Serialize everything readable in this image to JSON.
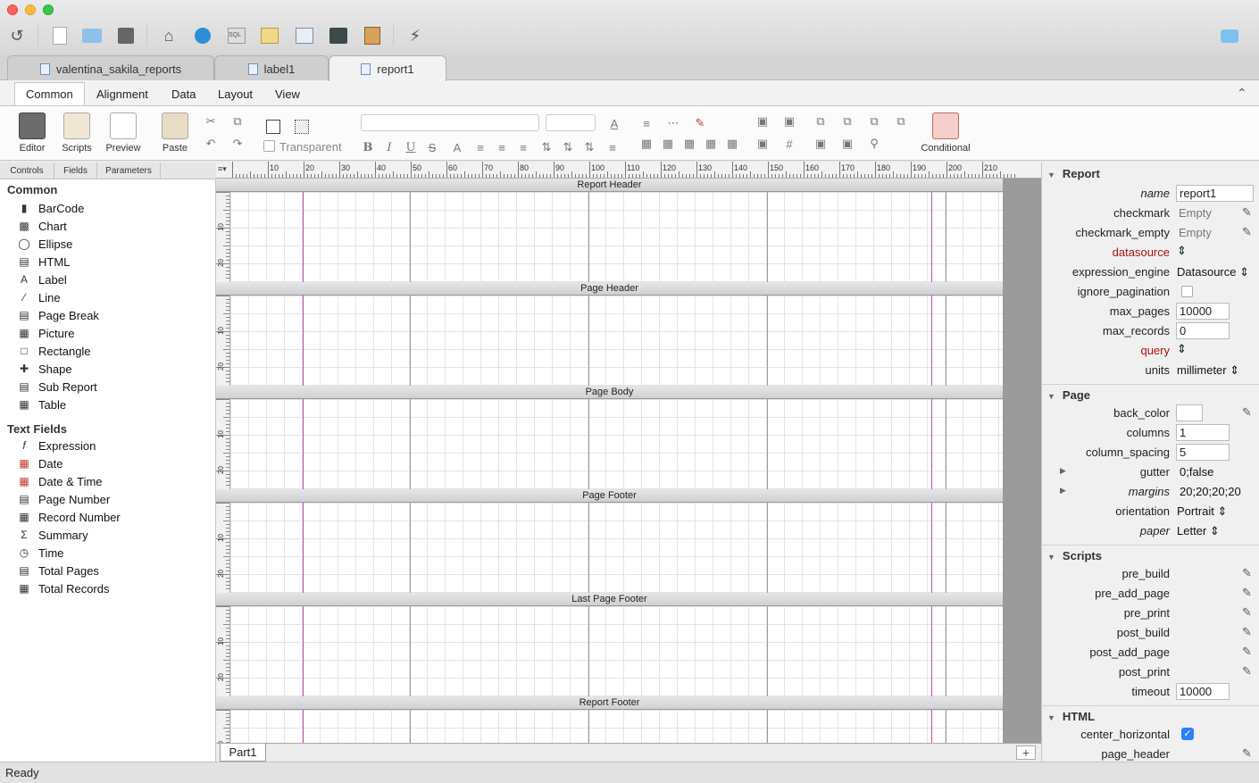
{
  "document_tabs": [
    {
      "label": "valentina_sakila_reports"
    },
    {
      "label": "label1"
    },
    {
      "label": "report1",
      "active": true
    }
  ],
  "ribbon_tabs": [
    "Common",
    "Alignment",
    "Data",
    "Layout",
    "View"
  ],
  "ribbon": {
    "editor": "Editor",
    "scripts": "Scripts",
    "preview": "Preview",
    "paste": "Paste",
    "transparent": "Transparent",
    "conditional": "Conditional"
  },
  "left_tabs": [
    "Controls",
    "Fields",
    "Parameters"
  ],
  "controls": {
    "common_title": "Common",
    "common": [
      "BarCode",
      "Chart",
      "Ellipse",
      "HTML",
      "Label",
      "Line",
      "Page Break",
      "Picture",
      "Rectangle",
      "Shape",
      "Sub Report",
      "Table"
    ],
    "text_fields_title": "Text Fields",
    "text_fields": [
      "Expression",
      "Date",
      "Date & Time",
      "Page Number",
      "Record Number",
      "Summary",
      "Time",
      "Total Pages",
      "Total Records"
    ]
  },
  "ruler_top": [
    "10",
    "20",
    "30",
    "40",
    "50",
    "60",
    "70",
    "80",
    "90",
    "100",
    "110",
    "120",
    "130",
    "140",
    "150",
    "160",
    "170",
    "180",
    "190",
    "200",
    "210"
  ],
  "ruler_side": [
    "10",
    "20"
  ],
  "bands": [
    "Report Header",
    "Page Header",
    "Page Body",
    "Page Footer",
    "Last Page Footer",
    "Report Footer"
  ],
  "part_tab": "Part1",
  "add_part": "+",
  "properties": {
    "report": {
      "title": "Report",
      "name_label": "name",
      "name": "report1",
      "checkmark_label": "checkmark",
      "checkmark": "Empty",
      "checkmark_empty_label": "checkmark_empty",
      "checkmark_empty": "Empty",
      "datasource_label": "datasource",
      "expression_engine_label": "expression_engine",
      "expression_engine": "Datasource",
      "ignore_pagination_label": "ignore_pagination",
      "max_pages_label": "max_pages",
      "max_pages": "10000",
      "max_records_label": "max_records",
      "max_records": "0",
      "query_label": "query",
      "units_label": "units",
      "units": "millimeter"
    },
    "page": {
      "title": "Page",
      "back_color_label": "back_color",
      "columns_label": "columns",
      "columns": "1",
      "column_spacing_label": "column_spacing",
      "column_spacing": "5",
      "gutter_label": "gutter",
      "gutter": "0;false",
      "margins_label": "margins",
      "margins": "20;20;20;20",
      "orientation_label": "orientation",
      "orientation": "Portrait",
      "paper_label": "paper",
      "paper": "Letter"
    },
    "scripts": {
      "title": "Scripts",
      "items": [
        "pre_build",
        "pre_add_page",
        "pre_print",
        "post_build",
        "post_add_page",
        "post_print"
      ],
      "timeout_label": "timeout",
      "timeout": "10000"
    },
    "html": {
      "title": "HTML",
      "center_horizontal_label": "center_horizontal",
      "page_header_label": "page_header"
    }
  },
  "status": "Ready",
  "colors": {
    "accent": "#2f7ff7",
    "guide": "#b54fb3"
  }
}
